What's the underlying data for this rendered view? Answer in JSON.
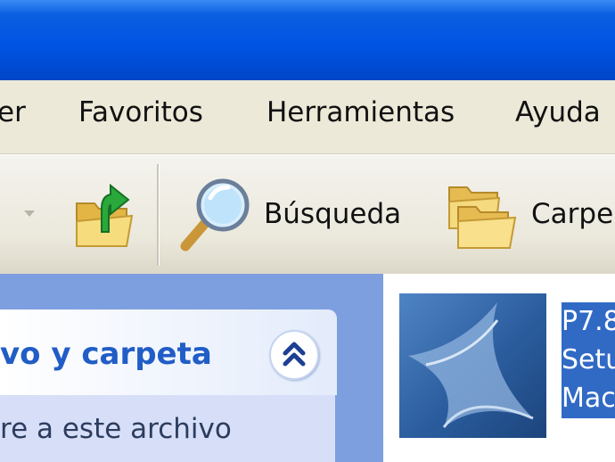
{
  "menu": {
    "items": [
      "er",
      "Favoritos",
      "Herramientas",
      "Ayuda"
    ]
  },
  "toolbar": {
    "up_icon": "folder-up-icon",
    "search_label": "Búsqueda",
    "folders_label": "Carpe"
  },
  "task_pane": {
    "title": "vo y carpeta",
    "link": "re a este archivo"
  },
  "file": {
    "line1": "P7.8",
    "line2": "Setu",
    "line3": "Mac"
  },
  "colors": {
    "title_bar": "#0054E3",
    "task_title": "#215DC6",
    "selection": "#316AC5",
    "pane_bg": "#7D9FE0"
  }
}
